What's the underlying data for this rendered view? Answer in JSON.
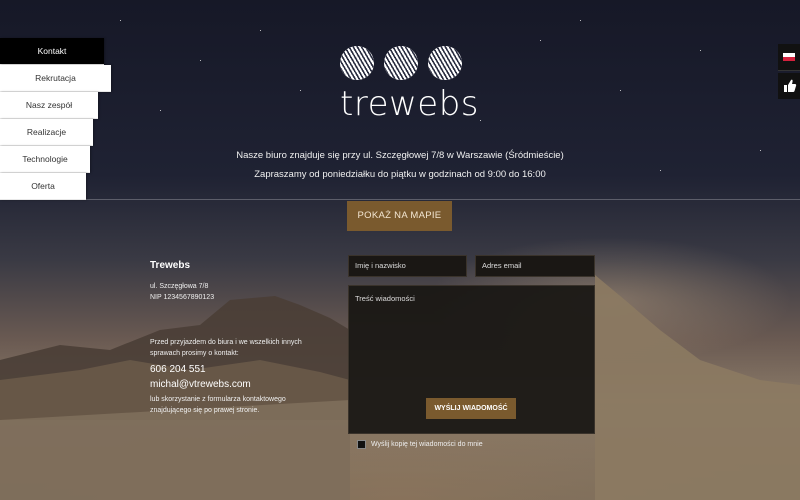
{
  "nav": {
    "items": [
      {
        "label": "Kontakt",
        "active": true
      },
      {
        "label": "Rekrutacja",
        "active": false
      },
      {
        "label": "Nasz zespół",
        "active": false
      },
      {
        "label": "Realizacje",
        "active": false
      },
      {
        "label": "Technologie",
        "active": false
      },
      {
        "label": "Oferta",
        "active": false
      }
    ]
  },
  "lang": {
    "flag": "poland-flag-icon"
  },
  "like": {
    "icon": "thumbs-up-icon"
  },
  "logo": {
    "name": "trewebs"
  },
  "info": {
    "line1": "Nasze biuro znajduje się przy ul. Szczęgłowej 7/8 w Warszawie (Śródmieście)",
    "line2": "Zapraszamy od poniedziałku do piątku w godzinach od 9:00 do 16:00"
  },
  "map_button": "POKAŻ NA MAPIE",
  "company": {
    "name": "Trewebs",
    "address": "ul. Szczęgłowa 7/8",
    "nip": "NIP 1234567890123",
    "note": "Przed przyjazdem do biura i we wszelkich innych sprawach prosimy o kontakt:",
    "phone": "606 204 551",
    "email": "michal@vtrewebs.com",
    "note2": "lub skorzystanie z formularza kontaktowego znajdującego się po prawej stronie."
  },
  "form": {
    "name_placeholder": "Imię i nazwisko",
    "email_placeholder": "Adres email",
    "message_placeholder": "Treść wiadomości",
    "send_label": "WYŚLIJ WIADOMOŚĆ",
    "copy_label": "Wyślij kopię tej wiadomości do mnie"
  },
  "colors": {
    "accent": "#7a5a2e",
    "nav_active": "#000000"
  }
}
